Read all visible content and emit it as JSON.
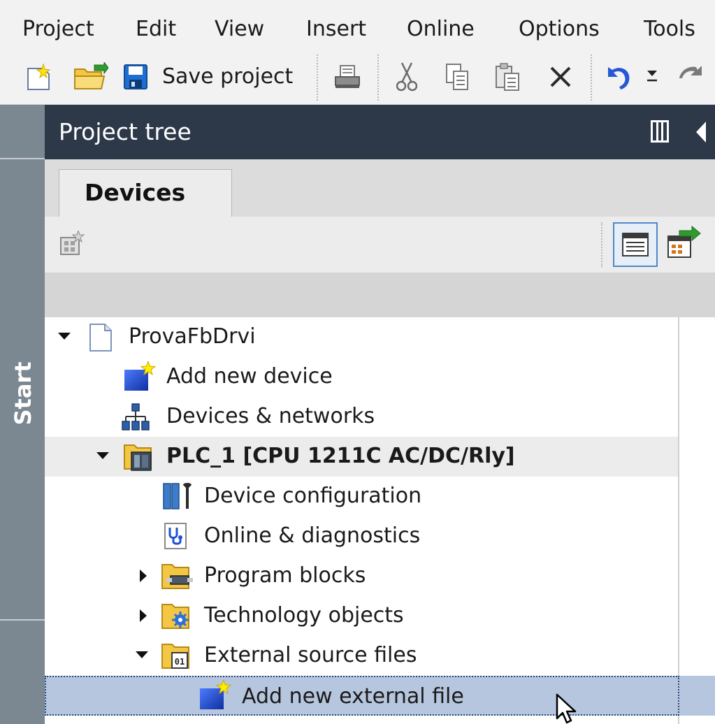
{
  "menu": {
    "items": [
      "Project",
      "Edit",
      "View",
      "Insert",
      "Online",
      "Options",
      "Tools"
    ]
  },
  "toolbar": {
    "save_label": "Save project",
    "icons": [
      "new-project-icon",
      "open-project-icon",
      "save-icon",
      "print-icon",
      "cut-icon",
      "copy-icon",
      "paste-icon",
      "delete-icon",
      "undo-icon",
      "redo-icon"
    ]
  },
  "side_strip": {
    "label": "Start"
  },
  "project_tree": {
    "title": "Project tree",
    "tab": "Devices"
  },
  "tree": {
    "items": [
      {
        "label": "ProvaFbDrvi",
        "icon": "project-icon",
        "state": "expanded"
      },
      {
        "label": "Add new device",
        "icon": "add-new-device-icon"
      },
      {
        "label": "Devices & networks",
        "icon": "network-icon"
      },
      {
        "label": "PLC_1 [CPU 1211C AC/DC/Rly]",
        "icon": "plc-icon",
        "state": "expanded"
      },
      {
        "label": "Device configuration",
        "icon": "device-config-icon"
      },
      {
        "label": "Online & diagnostics",
        "icon": "diagnostics-icon"
      },
      {
        "label": "Program blocks",
        "icon": "program-blocks-folder-icon",
        "state": "collapsed"
      },
      {
        "label": "Technology objects",
        "icon": "technology-folder-icon",
        "state": "collapsed"
      },
      {
        "label": "External source files",
        "icon": "external-source-folder-icon",
        "state": "expanded"
      },
      {
        "label": "Add new external file",
        "icon": "add-new-file-icon",
        "state": "selected"
      }
    ]
  },
  "colors": {
    "header_bg": "#2d3849",
    "side_strip": "#7b8791",
    "selection": "#b6c6de",
    "accent_blue": "#1f4fd6"
  }
}
